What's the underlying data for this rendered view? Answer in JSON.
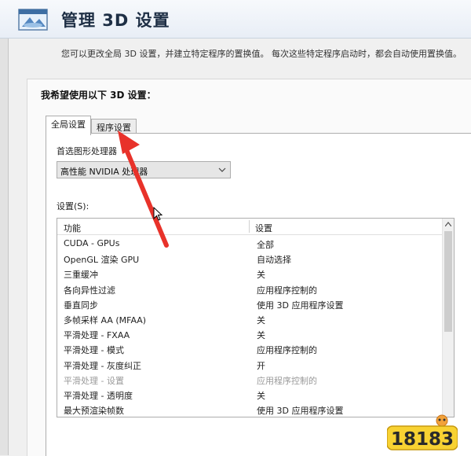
{
  "header": {
    "title": "管理 3D 设置",
    "icon": "nvidia-3d-settings-icon",
    "description": "您可以更改全局 3D 设置，并建立特定程序的置换值。 每次这些特定程序启动时，都会自动使用置换值。"
  },
  "panel": {
    "heading": "我希望使用以下 3D 设置："
  },
  "tabs": [
    {
      "label": "全局设置",
      "active": true
    },
    {
      "label": "程序设置",
      "active": false
    }
  ],
  "gpu_select": {
    "label": "首选图形处理器",
    "value": "高性能 NVIDIA 处理器"
  },
  "settings": {
    "label": "设置(S):",
    "columns": {
      "feature": "功能",
      "setting": "设置"
    },
    "rows": [
      {
        "feature": "CUDA - GPUs",
        "value": "全部"
      },
      {
        "feature": "OpenGL 渲染 GPU",
        "value": "自动选择"
      },
      {
        "feature": "三重缓冲",
        "value": "关"
      },
      {
        "feature": "各向异性过滤",
        "value": "应用程序控制的"
      },
      {
        "feature": "垂直同步",
        "value": "使用 3D 应用程序设置"
      },
      {
        "feature": "多帧采样 AA (MFAA)",
        "value": "关"
      },
      {
        "feature": "平滑处理 - FXAA",
        "value": "关"
      },
      {
        "feature": "平滑处理 - 模式",
        "value": "应用程序控制的"
      },
      {
        "feature": "平滑处理 - 灰度纠正",
        "value": "开"
      },
      {
        "feature": "平滑处理 - 设置",
        "value": "应用程序控制的",
        "disabled": true
      },
      {
        "feature": "平滑处理 - 透明度",
        "value": "关"
      },
      {
        "feature": "最大预渲染帧数",
        "value": "使用 3D 应用程序设置"
      }
    ]
  },
  "annotation": {
    "color": "#e8322a"
  },
  "watermark": {
    "text": "18183"
  }
}
